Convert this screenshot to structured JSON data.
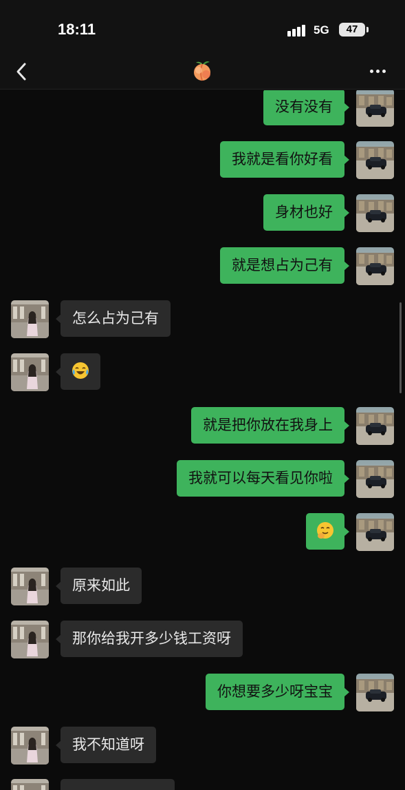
{
  "status_bar": {
    "time": "18:11",
    "network": "5G",
    "battery": "47"
  },
  "nav": {
    "title_icon": "peach-emoji",
    "back_icon": "chevron-left-icon",
    "more_icon": "more-dots-icon"
  },
  "colors": {
    "me_bubble": "#3eb35c",
    "them_bubble": "#2b2b2b",
    "background": "#0b0b0b"
  },
  "messages": [
    {
      "sender": "me",
      "text": "没有没有"
    },
    {
      "sender": "me",
      "text": "我就是看你好看"
    },
    {
      "sender": "me",
      "text": "身材也好"
    },
    {
      "sender": "me",
      "text": "就是想占为己有"
    },
    {
      "sender": "them",
      "text": "怎么占为己有"
    },
    {
      "sender": "them",
      "text": "",
      "emoji": "laughing-crying-emoji"
    },
    {
      "sender": "me",
      "text": "就是把你放在我身上"
    },
    {
      "sender": "me",
      "text": "我就可以每天看见你啦"
    },
    {
      "sender": "me",
      "text": "",
      "emoji": "giggle-emoji"
    },
    {
      "sender": "them",
      "text": "原来如此"
    },
    {
      "sender": "them",
      "text": "那你给我开多少钱工资呀"
    },
    {
      "sender": "me",
      "text": "你想要多少呀宝宝"
    },
    {
      "sender": "them",
      "text": "我不知道呀"
    },
    {
      "sender": "them",
      "text": ""
    }
  ]
}
